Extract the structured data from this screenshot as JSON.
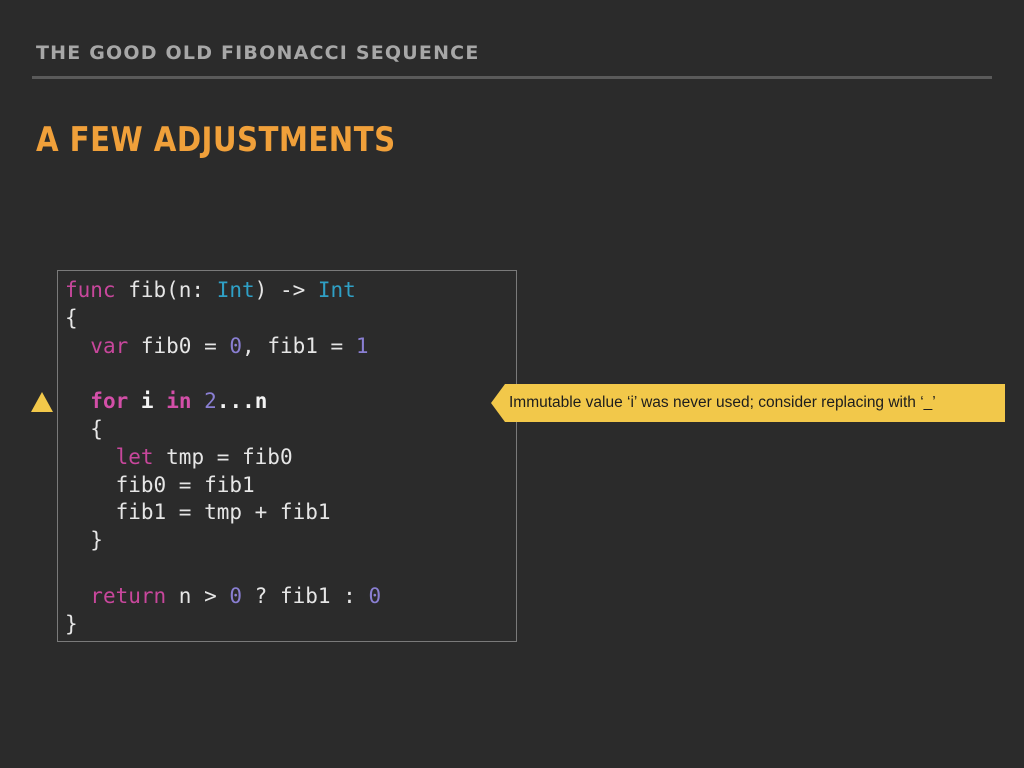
{
  "slide": {
    "section_heading": "THE GOOD OLD FIBONACCI SEQUENCE",
    "title": "A FEW ADJUSTMENTS"
  },
  "code": {
    "lines": [
      [
        {
          "t": "func",
          "c": "kw"
        },
        {
          "t": " fib(n: ",
          "c": ""
        },
        {
          "t": "Int",
          "c": "ty"
        },
        {
          "t": ") -> ",
          "c": ""
        },
        {
          "t": "Int",
          "c": "ty"
        }
      ],
      [
        {
          "t": "{",
          "c": ""
        }
      ],
      [
        {
          "t": "  ",
          "c": ""
        },
        {
          "t": "var",
          "c": "kw"
        },
        {
          "t": " fib0 = ",
          "c": ""
        },
        {
          "t": "0",
          "c": "num"
        },
        {
          "t": ", fib1 = ",
          "c": ""
        },
        {
          "t": "1",
          "c": "num"
        }
      ],
      [
        {
          "t": "",
          "c": ""
        }
      ],
      [
        {
          "t": "  ",
          "c": ""
        },
        {
          "t": "for",
          "c": "kwb"
        },
        {
          "t": " ",
          "c": ""
        },
        {
          "t": "i",
          "c": "bold"
        },
        {
          "t": " ",
          "c": ""
        },
        {
          "t": "in",
          "c": "kwb"
        },
        {
          "t": " ",
          "c": ""
        },
        {
          "t": "2",
          "c": "num"
        },
        {
          "t": "...",
          "c": "bold"
        },
        {
          "t": "n",
          "c": "bold"
        }
      ],
      [
        {
          "t": "  {",
          "c": ""
        }
      ],
      [
        {
          "t": "    ",
          "c": ""
        },
        {
          "t": "let",
          "c": "kw"
        },
        {
          "t": " tmp = fib0",
          "c": ""
        }
      ],
      [
        {
          "t": "    fib0 = fib1",
          "c": ""
        }
      ],
      [
        {
          "t": "    fib1 = tmp + fib1",
          "c": ""
        }
      ],
      [
        {
          "t": "  }",
          "c": ""
        }
      ],
      [
        {
          "t": "",
          "c": ""
        }
      ],
      [
        {
          "t": "  ",
          "c": ""
        },
        {
          "t": "return",
          "c": "kw"
        },
        {
          "t": " n > ",
          "c": ""
        },
        {
          "t": "0",
          "c": "num"
        },
        {
          "t": " ? fib1 : ",
          "c": ""
        },
        {
          "t": "0",
          "c": "num"
        }
      ],
      [
        {
          "t": "}",
          "c": ""
        }
      ]
    ]
  },
  "warning": {
    "icon": "warning-triangle-icon",
    "message": "Immutable value ‘i’ was never used; consider replacing with ‘_’",
    "color": "#f2c84a"
  },
  "colors": {
    "background": "#2b2b2b",
    "title": "#f0a03a",
    "heading": "#a7a7a7",
    "keyword": "#c8479c",
    "type": "#2fa0c6",
    "number": "#8a7fd3"
  }
}
